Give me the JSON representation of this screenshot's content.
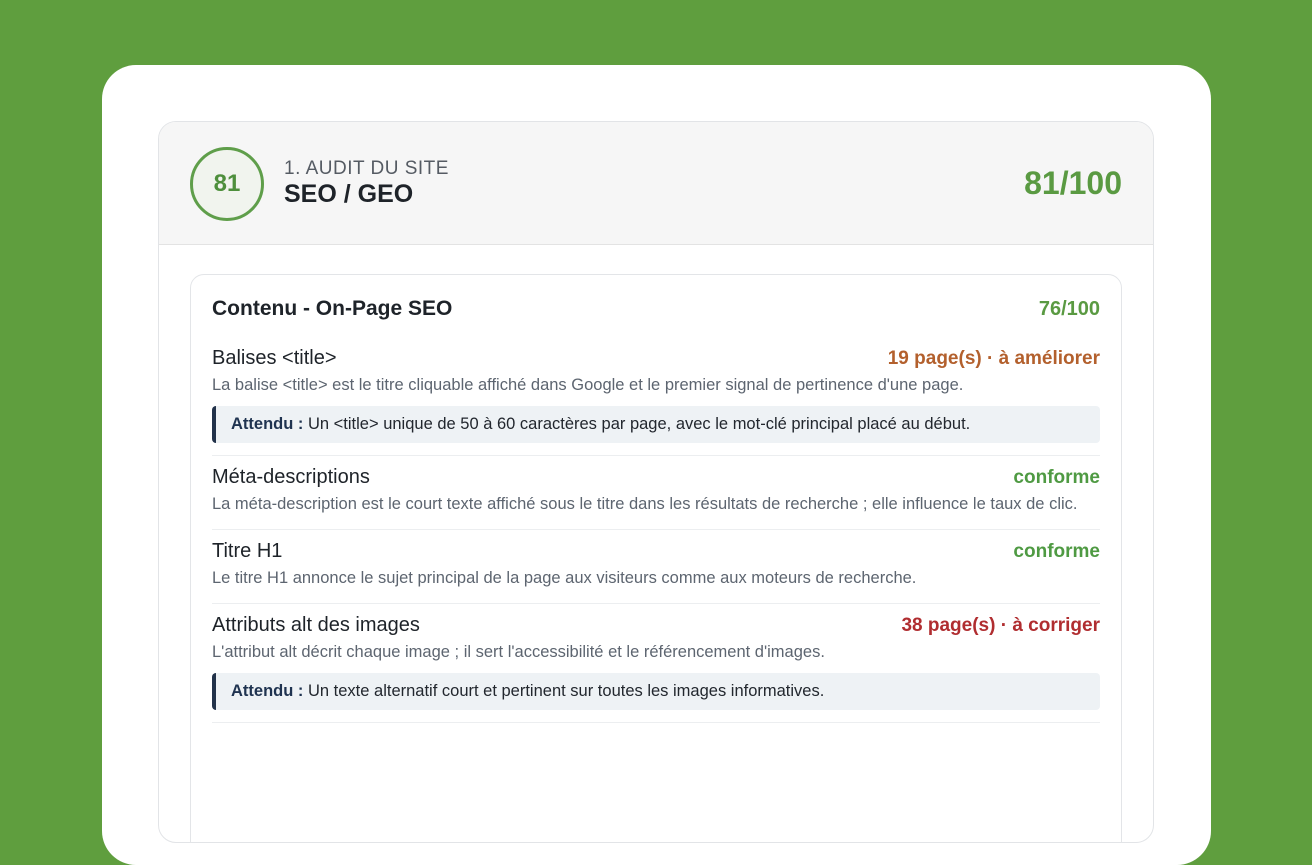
{
  "header": {
    "score_badge": "81",
    "kicker": "1. AUDIT DU SITE",
    "title": "SEO / GEO",
    "total": "81/100"
  },
  "section": {
    "title": "Contenu - On-Page SEO",
    "score": "76/100",
    "items": [
      {
        "name": "Balises <title>",
        "status": "19 page(s) · à améliorer",
        "description": "La balise <title> est le titre cliquable affiché dans Google et le premier signal de pertinence d'une page.",
        "expected_label": "Attendu :",
        "expected": " Un <title> unique de 50 à 60 caractères par page, avec le mot-clé principal placé au début."
      },
      {
        "name": "Méta-descriptions",
        "status": "conforme",
        "description": "La méta-description est le court texte affiché sous le titre dans les résultats de recherche ; elle influence le taux de clic."
      },
      {
        "name": "Titre H1",
        "status": "conforme",
        "description": "Le titre H1 annonce le sujet principal de la page aux visiteurs comme aux moteurs de recherche."
      },
      {
        "name": "Attributs alt des images",
        "status": "38 page(s) · à corriger",
        "description": "L'attribut alt décrit chaque image ; il sert l'accessibilité et le référencement d'images.",
        "expected_label": "Attendu :",
        "expected": " Un texte alternatif court et pertinent sur toutes les images informatives."
      }
    ]
  },
  "colors": {
    "background": "#5f9e3e",
    "score_green": "#5a9a42",
    "status_improve": "#b3602d",
    "status_ok": "#4f9a43",
    "status_fix": "#b02d30",
    "expected_border": "#22324a"
  }
}
